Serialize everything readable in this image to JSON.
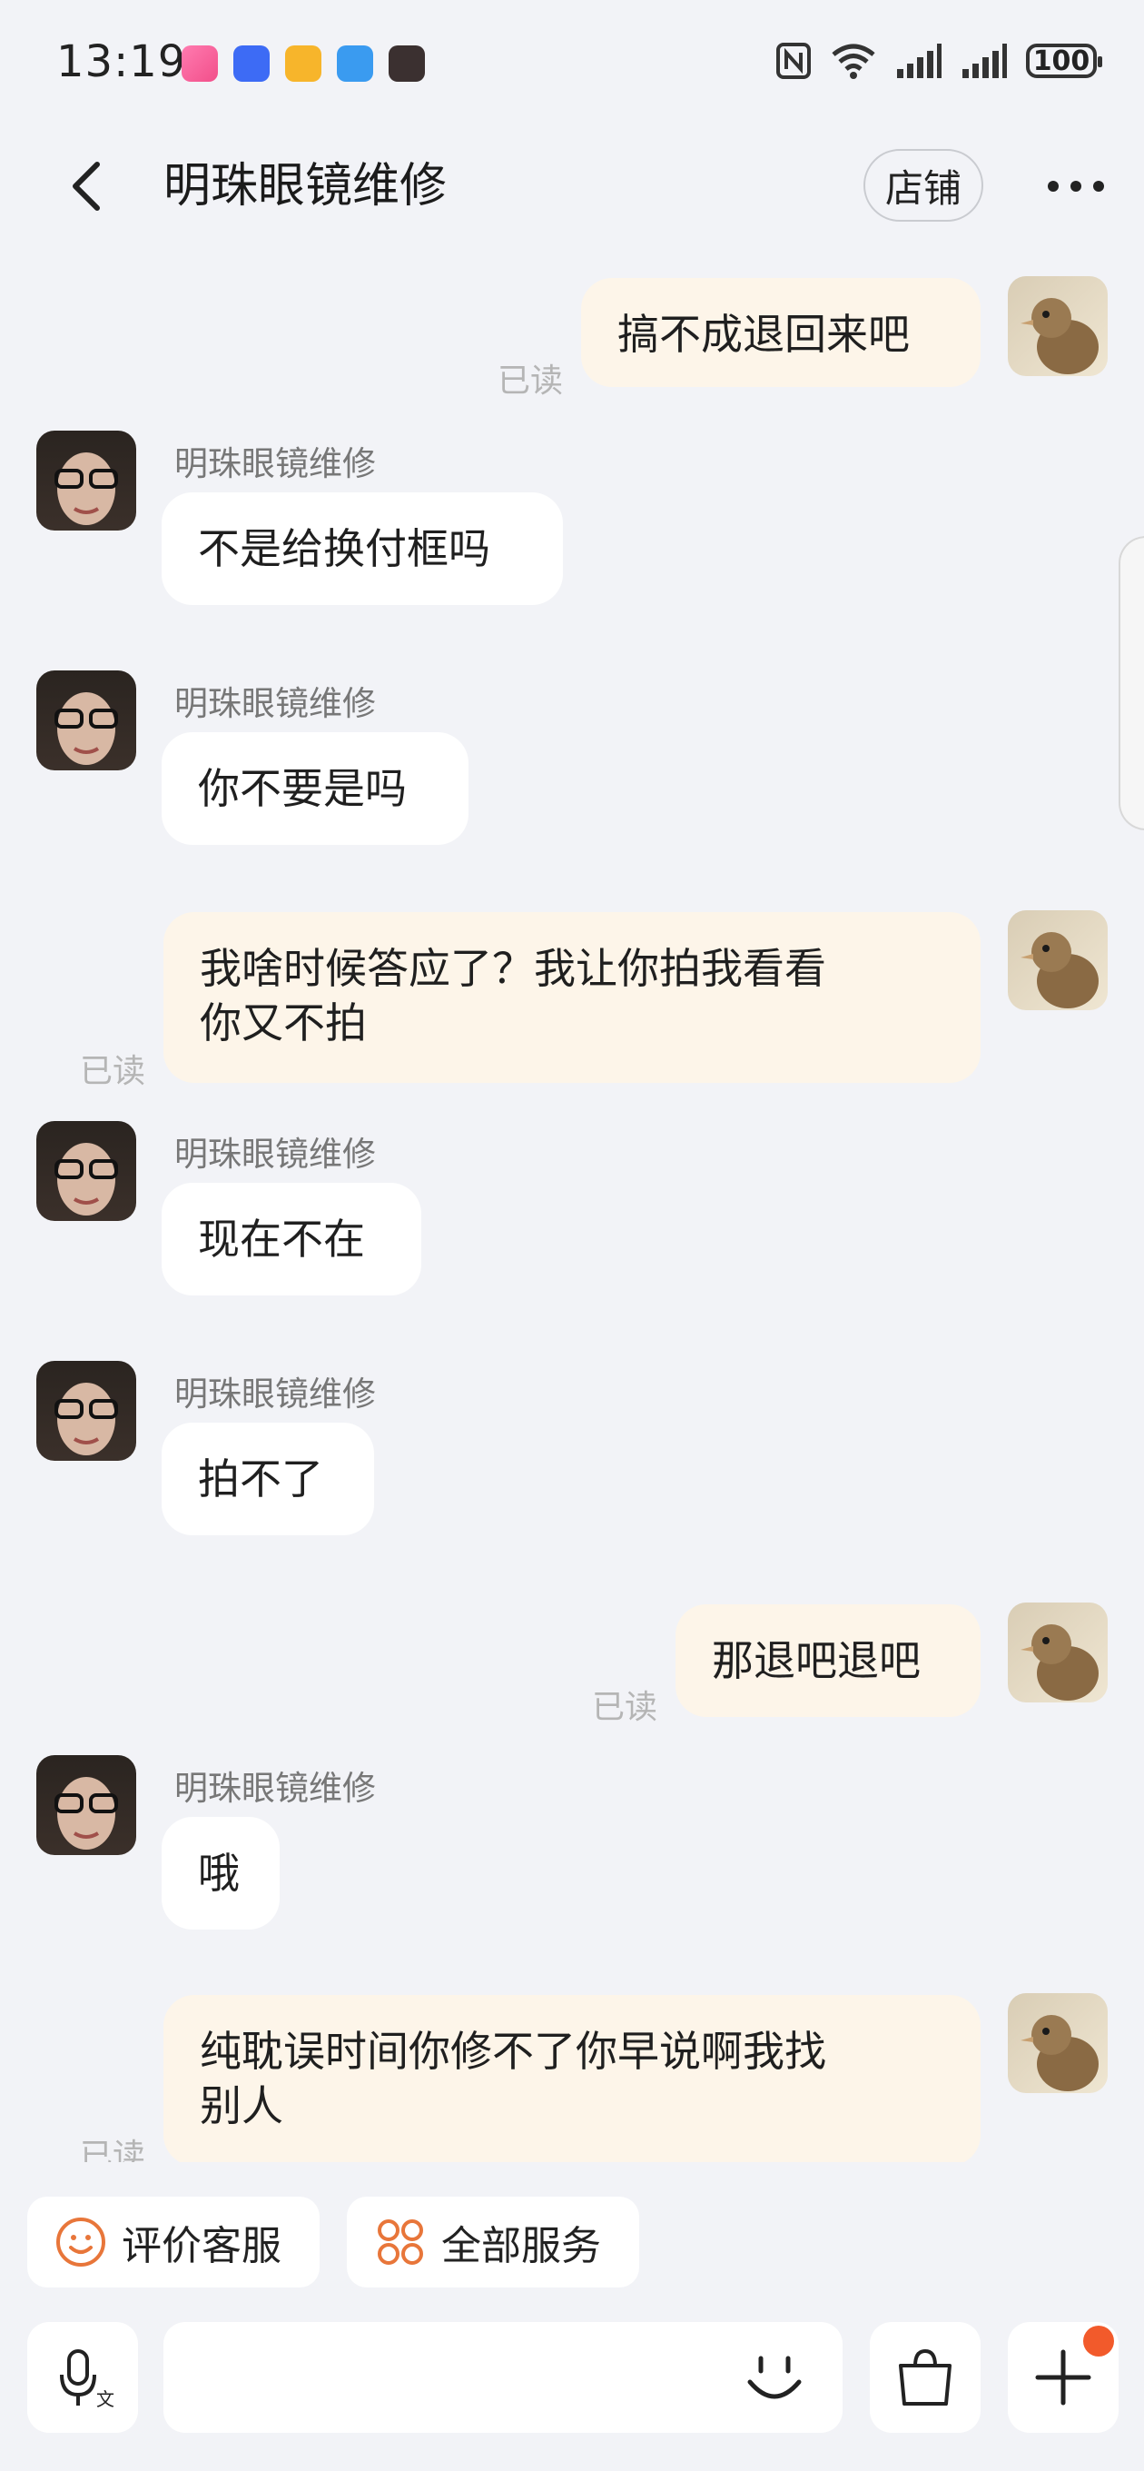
{
  "status_bar": {
    "time": "13:19",
    "battery": "100",
    "app_icons": [
      "bilibili-icon",
      "voice-app-icon",
      "mail-app-icon",
      "message-app-icon",
      "game-app-icon"
    ],
    "right_icons": [
      "nfc-icon",
      "wifi-icon",
      "signal-icon",
      "signal-icon"
    ]
  },
  "header": {
    "title": "明珠眼镜维修",
    "shop_label": "店铺"
  },
  "messages": [
    {
      "side": "right",
      "text": "搞不成退回来吧",
      "read": "已读"
    },
    {
      "side": "left",
      "sender": "明珠眼镜维修",
      "text": "不是给换付框吗"
    },
    {
      "side": "left",
      "sender": "明珠眼镜维修",
      "text": "你不要是吗"
    },
    {
      "side": "right",
      "text_line1": "我啥时候答应了？我让你拍我看看",
      "text_line2": "你又不拍",
      "read": "已读"
    },
    {
      "side": "left",
      "sender": "明珠眼镜维修",
      "text": "现在不在"
    },
    {
      "side": "left",
      "sender": "明珠眼镜维修",
      "text": "拍不了"
    },
    {
      "side": "right",
      "text": "那退吧退吧",
      "read": "已读"
    },
    {
      "side": "left",
      "sender": "明珠眼镜维修",
      "text": "哦"
    },
    {
      "side": "right",
      "text_line1": "纯耽误时间你修不了你早说啊我找",
      "text_line2": "别人",
      "read": "已读"
    }
  ],
  "quick_actions": {
    "rate_label": "评价客服",
    "services_label": "全部服务"
  },
  "colors": {
    "background": "#f2f3f7",
    "my_bubble": "#fdf5e9",
    "their_bubble": "#ffffff",
    "accent": "#e8763a",
    "badge": "#f25a2b"
  }
}
